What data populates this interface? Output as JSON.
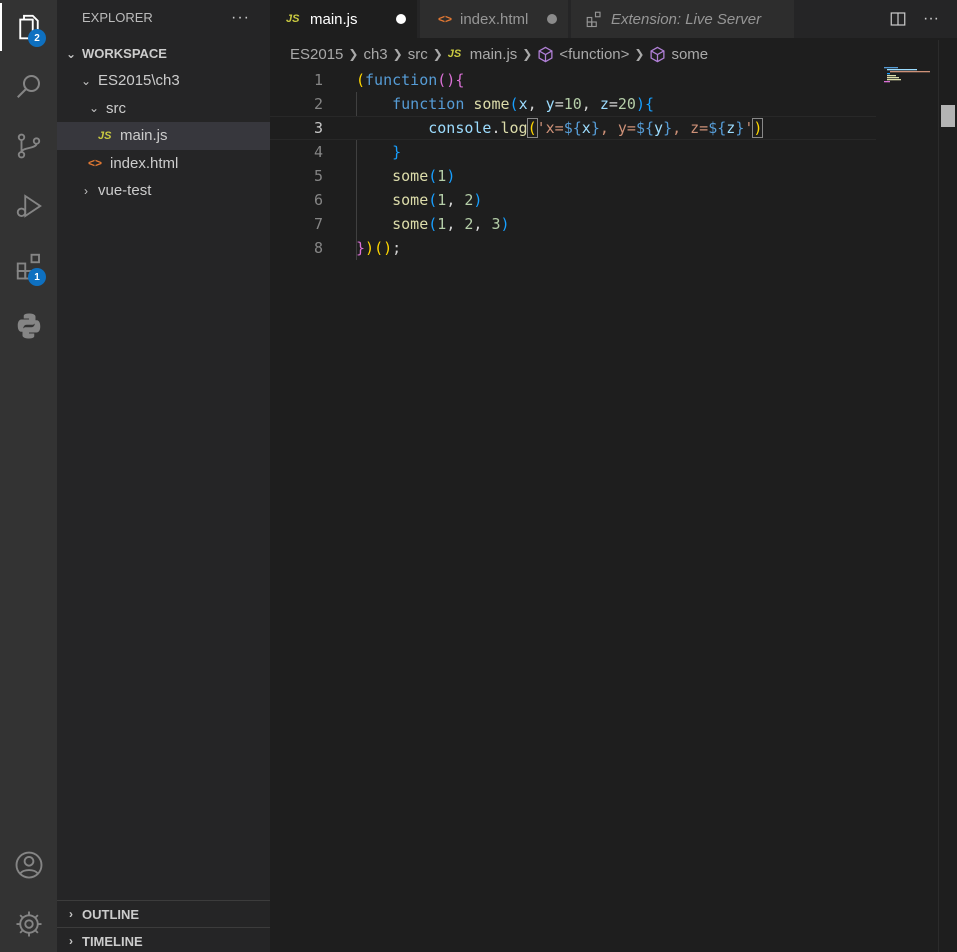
{
  "activity_bar": {
    "explorer_badge": "2",
    "extensions_badge": "1"
  },
  "sidebar": {
    "header": "EXPLORER",
    "more": "···",
    "workspace_title": "WORKSPACE",
    "tree": {
      "folder_es2015": "ES2015\\ch3",
      "folder_src": "src",
      "file_main": "main.js",
      "file_index": "index.html",
      "folder_vue": "vue-test",
      "js_badge": "JS",
      "html_badge": "<>"
    },
    "outline": "OUTLINE",
    "timeline": "TIMELINE"
  },
  "tabs": [
    {
      "label": "main.js",
      "icon": "JS"
    },
    {
      "label": "index.html",
      "icon": "<>"
    },
    {
      "label": "Extension: Live Server"
    }
  ],
  "breadcrumb": {
    "items": [
      "ES2015",
      "ch3",
      "src",
      "main.js",
      "<function>",
      "some"
    ],
    "js_badge": "JS"
  },
  "editor": {
    "line_numbers": [
      "1",
      "2",
      "3",
      "4",
      "5",
      "6",
      "7",
      "8"
    ],
    "current_line": 3
  },
  "colors": {
    "background": "#1e1e1e",
    "sidebar": "#252526",
    "activity_bar": "#333333",
    "badge": "#0e70c0"
  }
}
